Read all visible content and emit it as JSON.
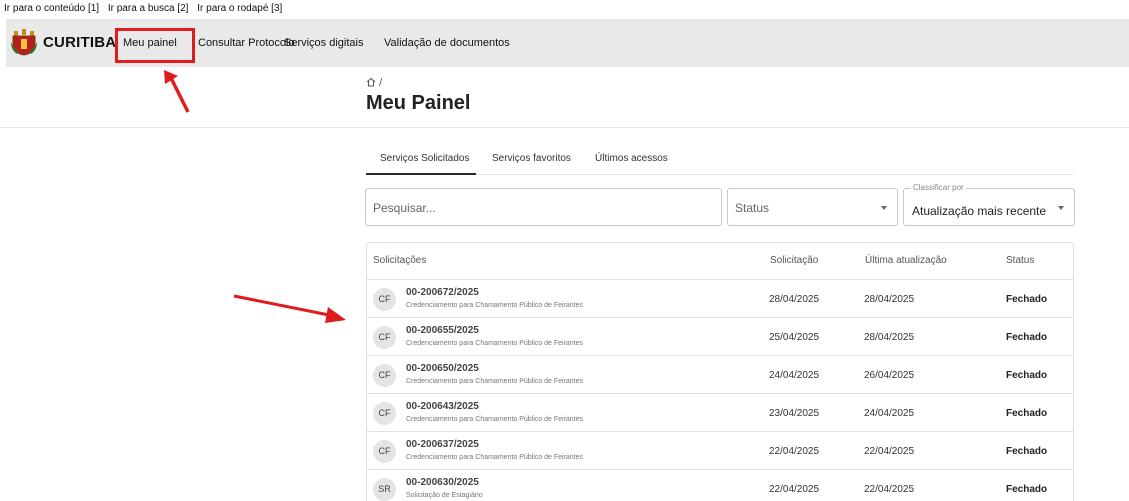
{
  "skip_links": [
    "Ir para o conteúdo [1]",
    "Ir para a busca [2]",
    "Ir para o rodapé [3]"
  ],
  "nav": {
    "logo_text": "CURITIBA",
    "items": [
      "Meu painel",
      "Consultar Protocolo",
      "Serviços digitais",
      "Validação de documentos"
    ]
  },
  "breadcrumb": "/",
  "page_title": "Meu Painel",
  "tabs": [
    "Serviços Solicitados",
    "Serviços favoritos",
    "Últimos acessos"
  ],
  "filters": {
    "search_placeholder": "Pesquisar...",
    "status_label": "Status",
    "sort_label": "Classificar por",
    "sort_value": "Atualização mais recente"
  },
  "table": {
    "headers": [
      "Solicitações",
      "Solicitação",
      "Última atualização",
      "Status"
    ],
    "rows": [
      {
        "avatar": "CF",
        "code": "00-200672/2025",
        "desc": "Credenciamento para Chamamento Público de Feirantes",
        "requested": "28/04/2025",
        "updated": "28/04/2025",
        "status": "Fechado"
      },
      {
        "avatar": "CF",
        "code": "00-200655/2025",
        "desc": "Credenciamento para Chamamento Público de Feirantes",
        "requested": "25/04/2025",
        "updated": "28/04/2025",
        "status": "Fechado"
      },
      {
        "avatar": "CF",
        "code": "00-200650/2025",
        "desc": "Credenciamento para Chamamento Público de Feirantes",
        "requested": "24/04/2025",
        "updated": "26/04/2025",
        "status": "Fechado"
      },
      {
        "avatar": "CF",
        "code": "00-200643/2025",
        "desc": "Credenciamento para Chamamento Público de Feirantes",
        "requested": "23/04/2025",
        "updated": "24/04/2025",
        "status": "Fechado"
      },
      {
        "avatar": "CF",
        "code": "00-200637/2025",
        "desc": "Credenciamento para Chamamento Público de Feirantes",
        "requested": "22/04/2025",
        "updated": "22/04/2025",
        "status": "Fechado"
      },
      {
        "avatar": "SR",
        "code": "00-200630/2025",
        "desc": "Solicitação de Estagiário",
        "requested": "22/04/2025",
        "updated": "22/04/2025",
        "status": "Fechado"
      }
    ]
  },
  "colors": {
    "annotation": "#e01b1b",
    "nav_bg": "#e9e9e9"
  },
  "icons": [
    "crest-icon",
    "home-icon",
    "chevron-down-icon",
    "arrow-annotation-icon"
  ]
}
